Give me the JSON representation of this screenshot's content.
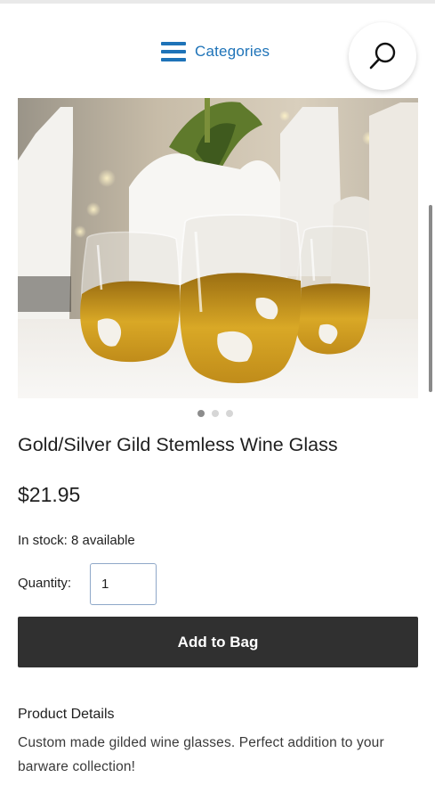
{
  "header": {
    "menu_icon": "hamburger-icon",
    "categories_label": "Categories",
    "search_icon": "search-icon",
    "accent_color": "#1e73b8"
  },
  "product": {
    "image_alt": "Gold/Silver Gild Stemless Wine Glass",
    "carousel": {
      "total_slides": 3,
      "active_slide": 1
    },
    "title": "Gold/Silver Gild Stemless Wine Glass",
    "price": "$21.95",
    "stock": "In stock: 8 available",
    "quantity_label": "Quantity:",
    "quantity_value": "1",
    "add_to_bag_label": "Add to Bag",
    "button_color": "#303030"
  },
  "details": {
    "heading": "Product Details",
    "text": "Custom made gilded wine glasses. Perfect addition to your barware collection!"
  }
}
